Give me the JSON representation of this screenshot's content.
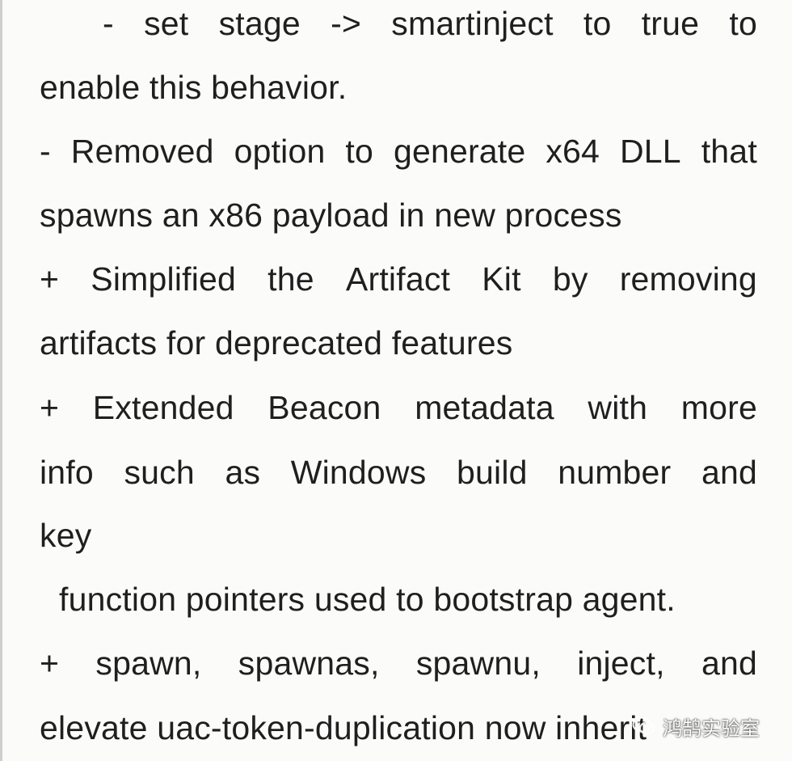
{
  "document": {
    "lines": [
      [
        "-",
        "set",
        "stage",
        "->",
        "smartinject",
        "to",
        "true",
        "to"
      ],
      "enable this behavior.",
      [
        "-",
        "Removed",
        "option",
        "to",
        "generate",
        "x64",
        "DLL",
        "that"
      ],
      "spawns an x86 payload in new process",
      [
        "+",
        "Simplified",
        "the",
        "Artifact",
        "Kit",
        "by",
        "removing"
      ],
      "artifacts for deprecated features",
      [
        "+",
        "Extended",
        "Beacon",
        "metadata",
        "with",
        "more"
      ],
      [
        "info",
        "such",
        "as",
        "Windows",
        "build",
        "number",
        "and"
      ],
      "key",
      "function pointers used to bootstrap agent.",
      [
        "+",
        "spawn,",
        "spawnas,",
        "spawnu,",
        "inject,",
        "and"
      ],
      "elevate uac-token-duplication now inherit"
    ]
  },
  "watermark": {
    "text": "鸿鹄实验室",
    "icon": "wechat-icon",
    "color": "#ffffff"
  }
}
